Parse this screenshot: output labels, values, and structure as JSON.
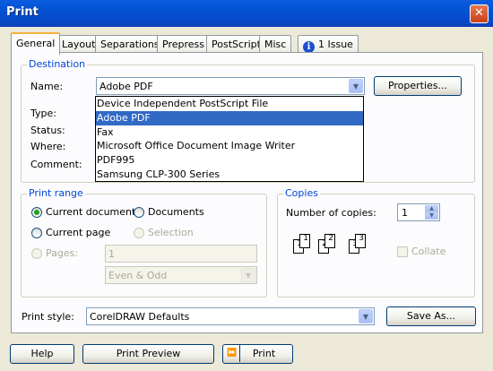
{
  "window": {
    "title": "Print",
    "close_symbol": "✕"
  },
  "tabs": [
    {
      "label": "General",
      "active": true
    },
    {
      "label": "Layout"
    },
    {
      "label": "Separations"
    },
    {
      "label": "Prepress"
    },
    {
      "label": "PostScript"
    },
    {
      "label": "Misc"
    },
    {
      "label": "1 Issue",
      "icon": "info-icon"
    }
  ],
  "destination": {
    "group_label": "Destination",
    "name_label": "Name:",
    "name_value": "Adobe PDF",
    "properties_button": "Properties...",
    "type_label": "Type:",
    "status_label": "Status:",
    "where_label": "Where:",
    "comment_label": "Comment:",
    "printer_options": [
      "Device Independent PostScript File",
      "Adobe PDF",
      "Fax",
      "Microsoft Office Document Image Writer",
      "PDF995",
      "Samsung CLP-300 Series"
    ],
    "selected_index": 1
  },
  "print_range": {
    "group_label": "Print range",
    "current_document": "Current document",
    "documents": "Documents",
    "current_page": "Current page",
    "selection": "Selection",
    "pages_label": "Pages:",
    "pages_value": "1",
    "even_odd": "Even & Odd",
    "selected": "current_document"
  },
  "copies": {
    "group_label": "Copies",
    "number_label": "Number of copies:",
    "number_value": "1",
    "collate_label": "Collate",
    "collate_checked": false,
    "page_numbers": [
      "1",
      "1",
      "2",
      "2",
      "3",
      "3"
    ]
  },
  "print_style": {
    "label": "Print style:",
    "value": "CorelDRAW Defaults",
    "save_as_button": "Save As..."
  },
  "footer": {
    "help_button": "Help",
    "preview_button": "Print Preview",
    "preview_arrow": "⏩",
    "print_button": "Print"
  },
  "colors": {
    "titlebar": "#0a5ddf",
    "group_label": "#0046d5",
    "selection": "#316ac5",
    "active_tab_accent": "#f6b33e"
  }
}
